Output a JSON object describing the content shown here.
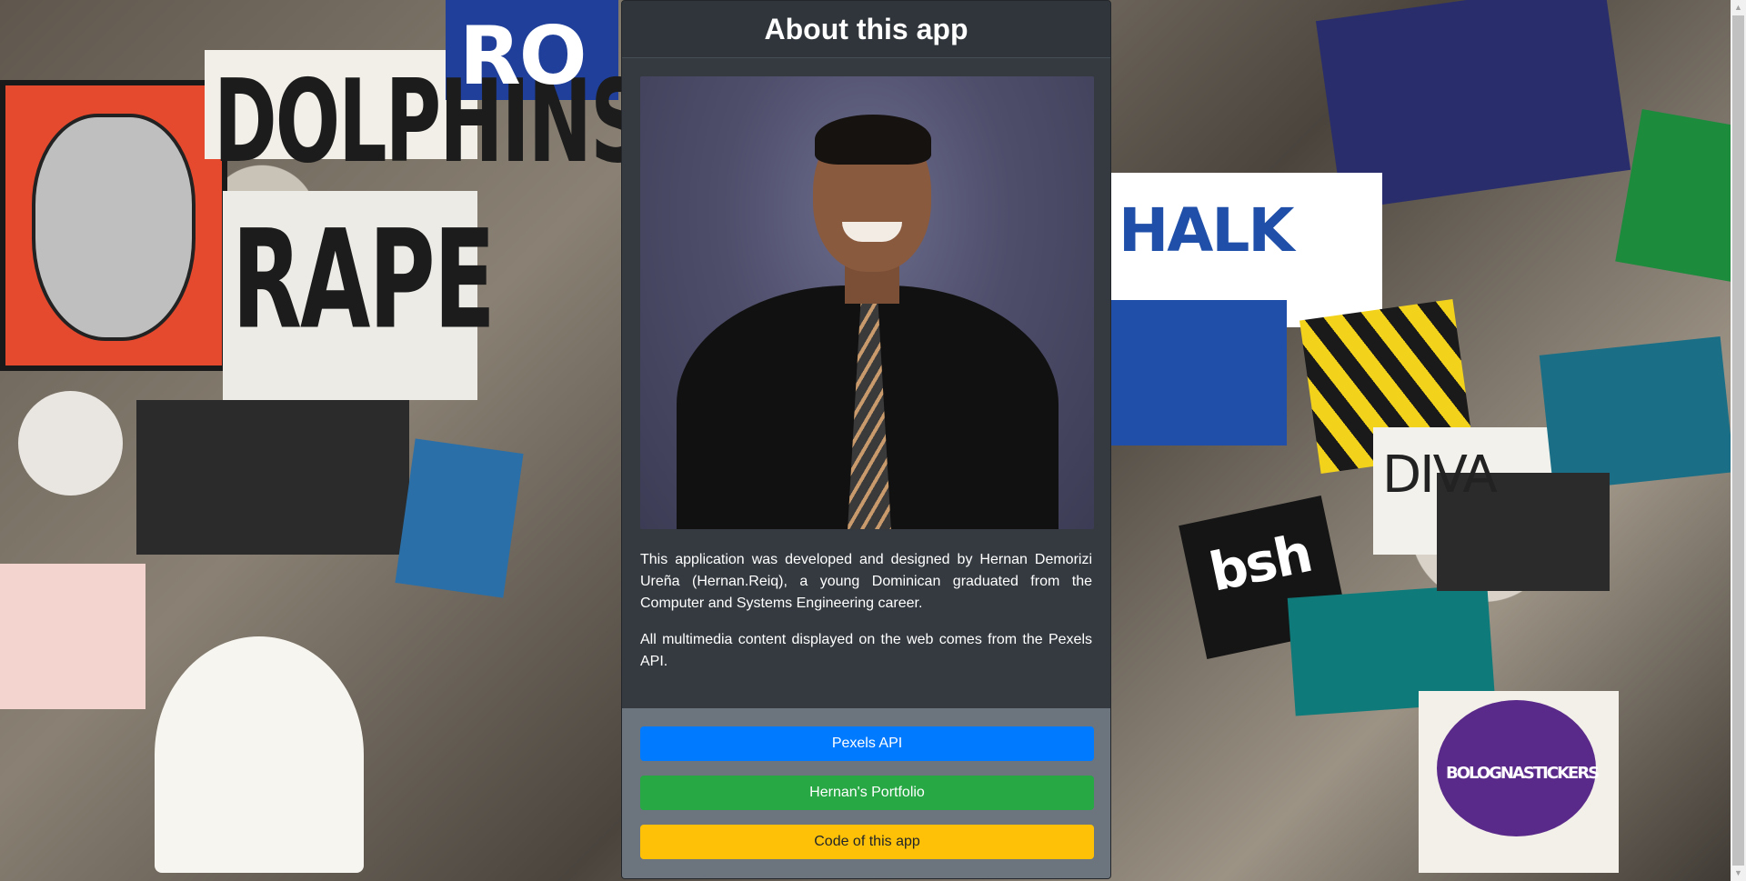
{
  "background": {
    "sticker_words": [
      "DOLPHINS",
      "RAPE",
      "RO",
      "HALK",
      "DIVA",
      "bsh",
      "BOLOGNASTICKERS"
    ]
  },
  "about": {
    "title": "About this app",
    "paragraphs": [
      "This application was developed and designed by Hernan Demorizi Ureña (Hernan.Reiq), a young Dominican graduated from the Computer and Systems Engineering career.",
      "All multimedia content displayed on the web comes from the Pexels API."
    ],
    "buttons": {
      "pexels": "Pexels API",
      "portfolio": "Hernan's Portfolio",
      "code": "Code of this app"
    },
    "colors": {
      "card_bg": "#343a40",
      "footer_bg": "#6c757d",
      "primary": "#007bff",
      "success": "#28a745",
      "warning": "#ffc107"
    }
  }
}
